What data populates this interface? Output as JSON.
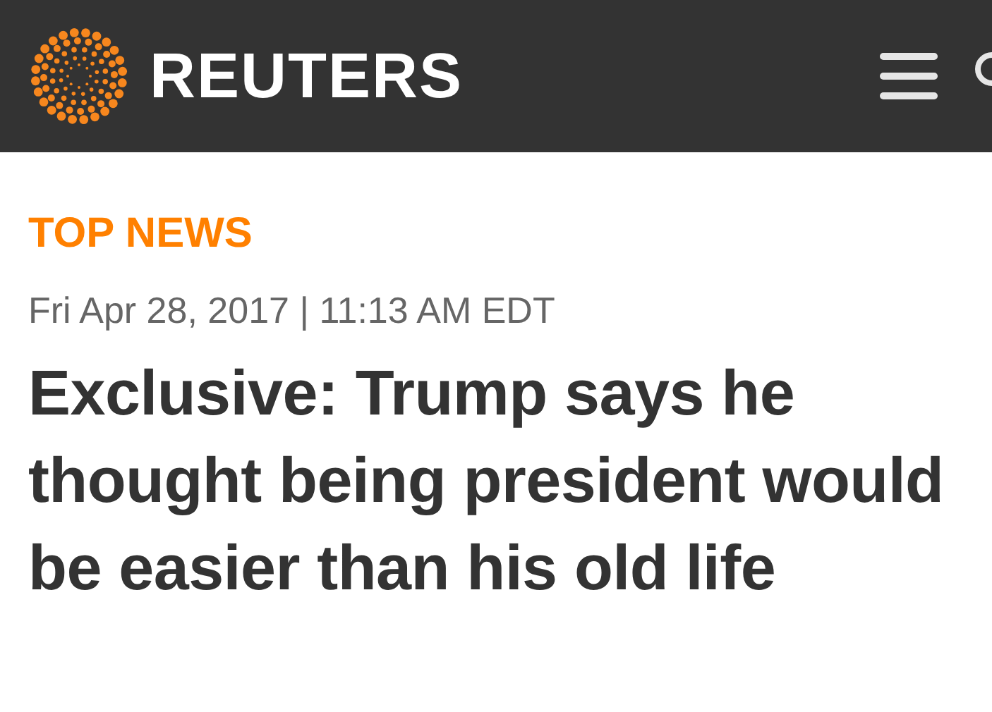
{
  "header": {
    "brand": "REUTERS"
  },
  "article": {
    "section": "TOP NEWS",
    "dateline": "Fri Apr 28, 2017 | 11:13 AM EDT",
    "headline": "Exclusive: Trump says he thought being president would be easier than his old life"
  }
}
